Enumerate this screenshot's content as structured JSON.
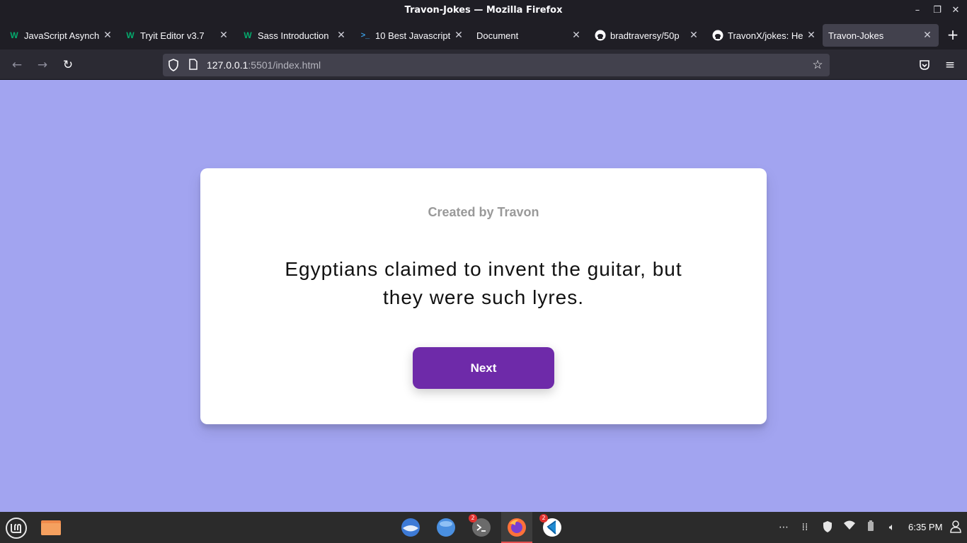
{
  "window": {
    "title": "Travon-Jokes — Mozilla Firefox"
  },
  "tabs": [
    {
      "label": "JavaScript Asynch",
      "favicon": "w3schools-icon",
      "active": false
    },
    {
      "label": "Tryit Editor v3.7",
      "favicon": "w3schools-icon",
      "active": false
    },
    {
      "label": "Sass Introduction",
      "favicon": "w3schools-icon",
      "active": false
    },
    {
      "label": "10 Best Javascript",
      "favicon": "terminal-prompt-icon",
      "active": false
    },
    {
      "label": "Document",
      "favicon": "",
      "active": false
    },
    {
      "label": "bradtraversy/50p",
      "favicon": "github-icon",
      "active": false
    },
    {
      "label": "TravonX/jokes: He",
      "favicon": "github-icon",
      "active": false
    },
    {
      "label": "Travon-Jokes",
      "favicon": "",
      "active": true
    }
  ],
  "navbar": {
    "url_host": "127.0.0.1",
    "url_rest": ":5501/index.html"
  },
  "page": {
    "credit": "Created by Travon",
    "joke": "Egyptians claimed to invent the guitar, but they were such lyres.",
    "next_label": "Next",
    "background": "#a2a4f0",
    "button_color": "#6e2aa9"
  },
  "taskbar": {
    "terminal_badge": "2",
    "vscode_badge": "2",
    "clock": "6:35 PM"
  }
}
